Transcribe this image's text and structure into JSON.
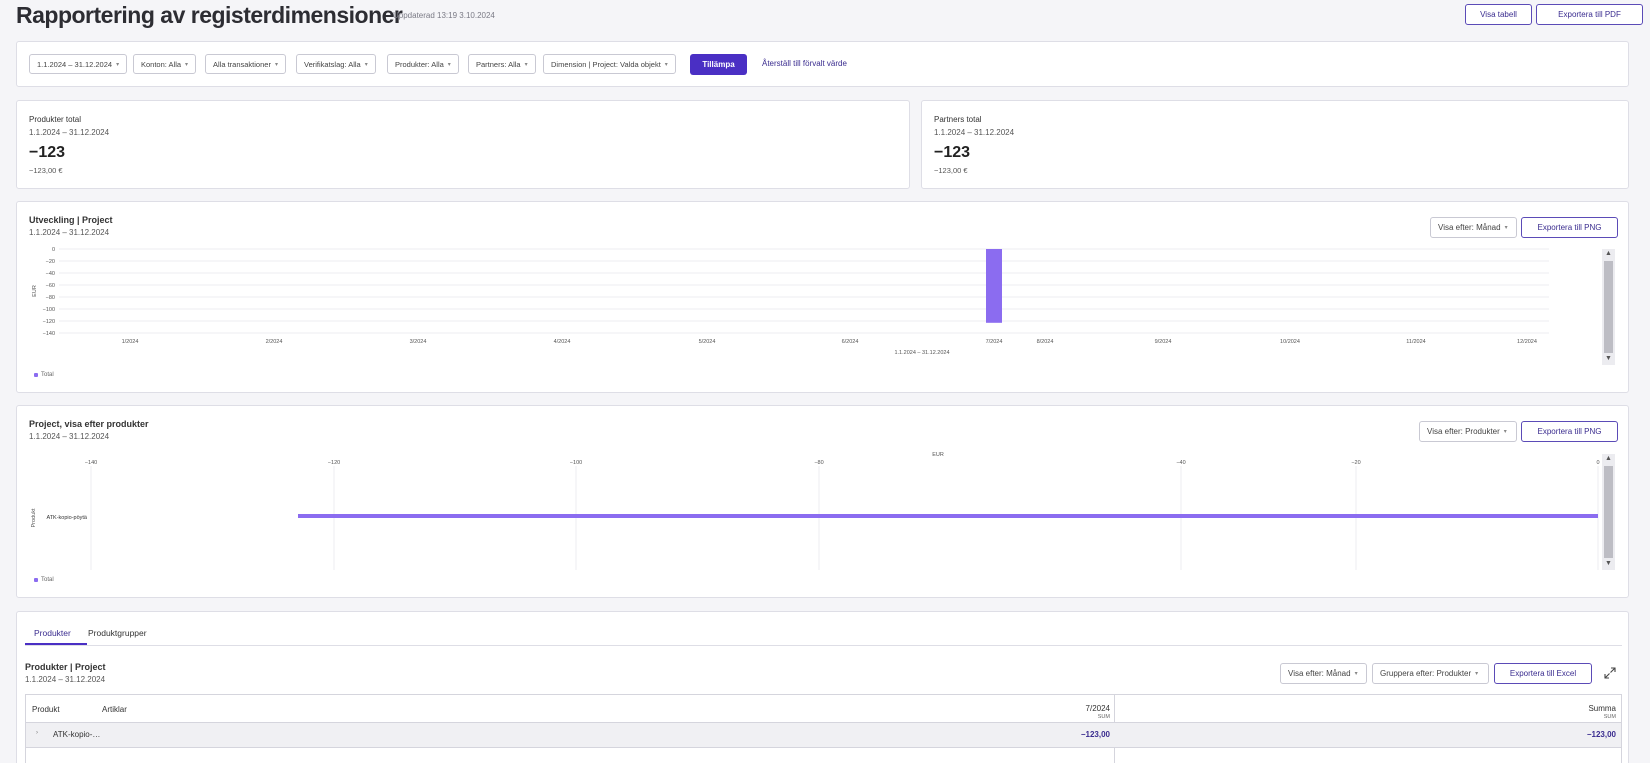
{
  "header": {
    "title": "Rapportering av registerdimensioner",
    "updated": "Uppdaterad 13:19 3.10.2024",
    "show_table_label": "Visa tabell",
    "export_pdf_label": "Exportera till PDF"
  },
  "filters": {
    "period": "1.1.2024 – 31.12.2024",
    "accounts": "Konton: Alla",
    "transactions": "Alla transaktioner",
    "voucher_type": "Verifikatslag: Alla",
    "products": "Produkter: Alla",
    "partners": "Partners: Alla",
    "dimension": "Dimension | Project: Valda objekt",
    "apply_label": "Tillämpa",
    "reset_label": "Återställ till förvalt värde"
  },
  "kpis": [
    {
      "label": "Produkter total",
      "range": "1.1.2024 – 31.12.2024",
      "value": "−123",
      "sub": "−123,00 €"
    },
    {
      "label": "Partners total",
      "range": "1.1.2024 – 31.12.2024",
      "value": "−123",
      "sub": "−123,00 €"
    }
  ],
  "development": {
    "title": "Utveckling | Project",
    "range": "1.1.2024 – 31.12.2024",
    "view_select": "Visa efter: Månad",
    "export_label": "Exportera till PNG",
    "legend": "Total"
  },
  "by_product": {
    "title": "Project, visa efter produkter",
    "range": "1.1.2024 – 31.12.2024",
    "view_select": "Visa efter: Produkter",
    "export_label": "Exportera till PNG",
    "legend": "Total"
  },
  "table_section": {
    "tabs": [
      "Produkter",
      "Produktgrupper"
    ],
    "title": "Produkter | Project",
    "range": "1.1.2024 – 31.12.2024",
    "view_select": "Visa efter: Månad",
    "group_select": "Gruppera efter: Produkter",
    "export_label": "Exportera till Excel",
    "columns": {
      "product": "Produkt",
      "articles": "Artiklar",
      "month": "7/2024",
      "month_sub": "SUM",
      "sum": "Summa",
      "sum_sub": "SUM"
    },
    "rows": [
      {
        "product": "ATK-kopio-…",
        "month_value": "−123,00",
        "sum_value": "−123,00"
      }
    ]
  },
  "chart_data": [
    {
      "type": "bar",
      "categories": [
        "1/2024",
        "2/2024",
        "3/2024",
        "4/2024",
        "5/2024",
        "6/2024",
        "7/2024",
        "8/2024",
        "9/2024",
        "10/2024",
        "11/2024",
        "12/2024"
      ],
      "series": [
        {
          "name": "Total",
          "values": [
            0,
            0,
            0,
            0,
            0,
            0,
            -123,
            0,
            0,
            0,
            0,
            0
          ]
        }
      ],
      "ylabel": "EUR",
      "xlabel": "1.1.2024 – 31.12.2024",
      "ylim": [
        -140,
        0
      ],
      "yticks": [
        0,
        -20,
        -40,
        -60,
        -80,
        -100,
        -120,
        -140
      ],
      "grid": true,
      "legend": "bottom-left",
      "color": "#8b6cf0"
    },
    {
      "type": "bar",
      "orientation": "horizontal",
      "categories": [
        "ATK-kopio-pöytä"
      ],
      "series": [
        {
          "name": "Total",
          "values": [
            -123
          ]
        }
      ],
      "xlabel": "EUR",
      "ylabel": "Produkt",
      "xlim": [
        -140,
        0
      ],
      "xticks": [
        -140,
        -120,
        -100,
        -80,
        -40,
        -20,
        0
      ],
      "grid": true,
      "legend": "bottom-left",
      "color": "#8b6cf0"
    }
  ]
}
